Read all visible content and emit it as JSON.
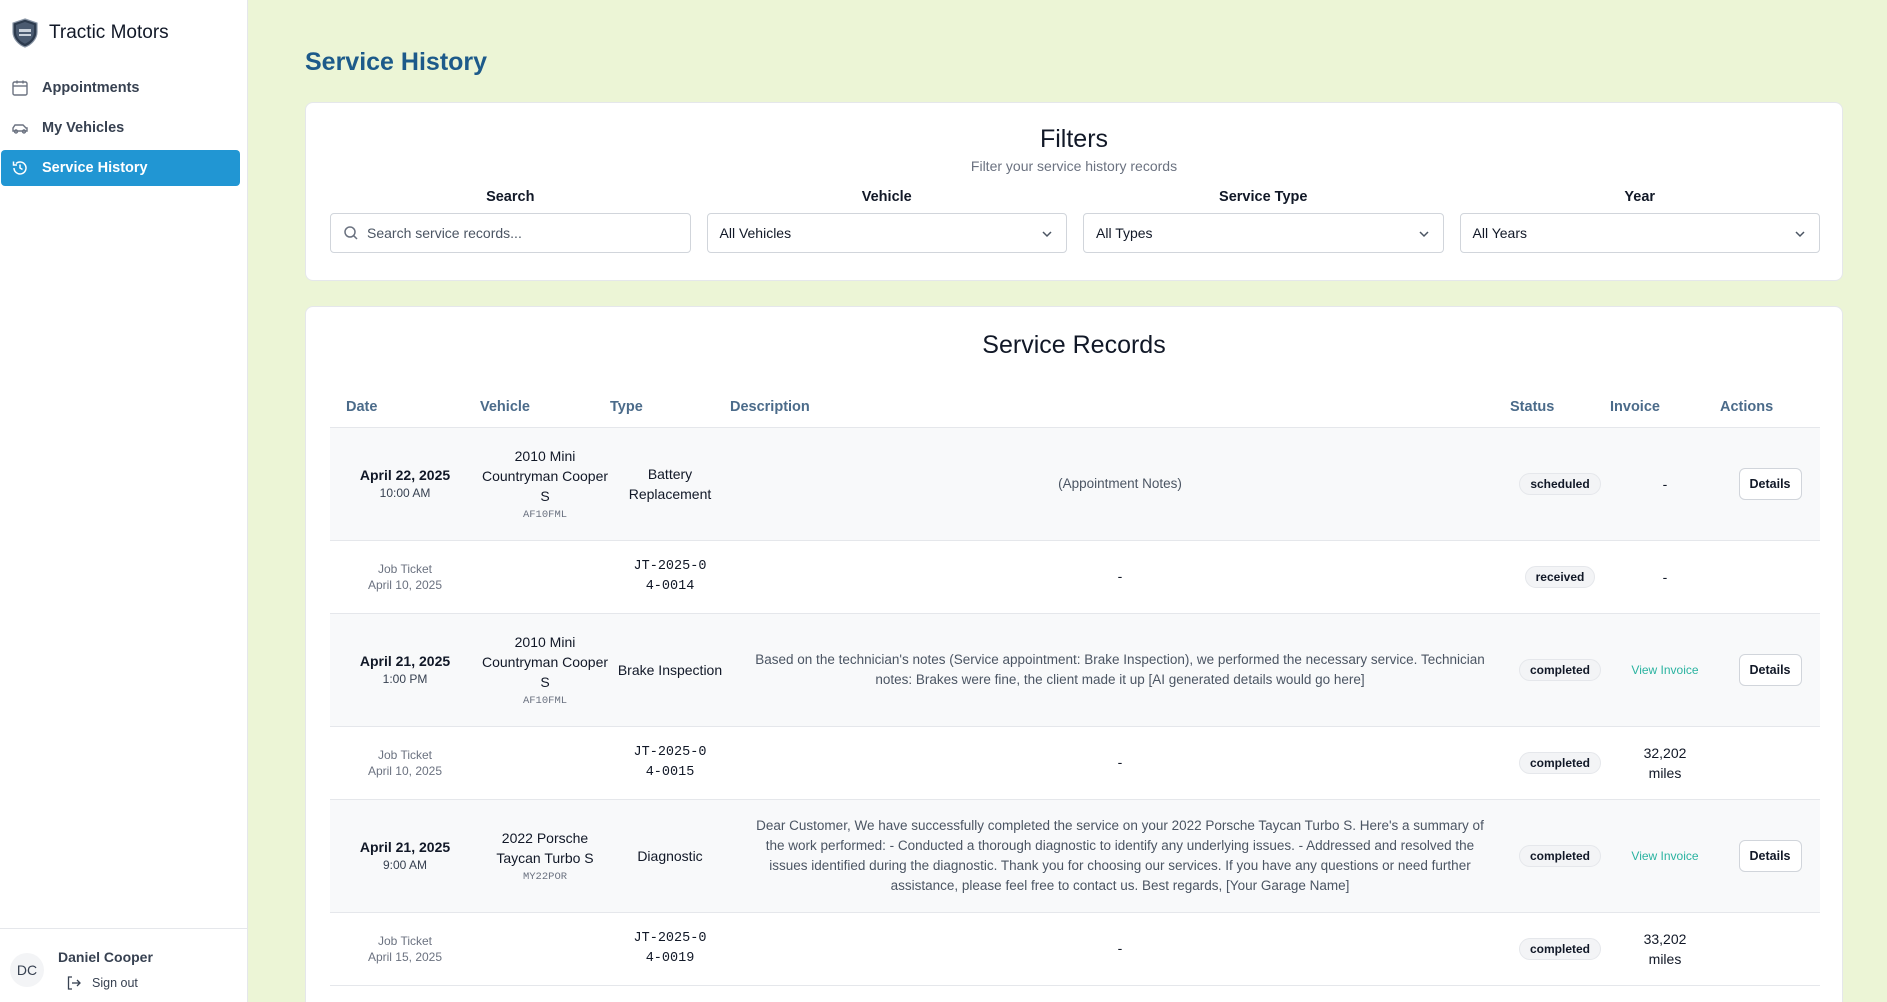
{
  "app": {
    "name": "Tractic Motors"
  },
  "sidebar": {
    "items": [
      {
        "label": "Appointments"
      },
      {
        "label": "My Vehicles"
      },
      {
        "label": "Service History"
      }
    ],
    "user": {
      "initials": "DC",
      "name": "Daniel Cooper",
      "signout_label": "Sign out"
    }
  },
  "page": {
    "title": "Service History"
  },
  "filters": {
    "title": "Filters",
    "subtitle": "Filter your service history records",
    "search_label": "Search",
    "search_placeholder": "Search service records...",
    "vehicle_label": "Vehicle",
    "vehicle_value": "All Vehicles",
    "type_label": "Service Type",
    "type_value": "All Types",
    "year_label": "Year",
    "year_value": "All Years"
  },
  "records": {
    "title": "Service Records",
    "headers": [
      "Date",
      "Vehicle",
      "Type",
      "Description",
      "Status",
      "Invoice",
      "Actions"
    ],
    "rows": [
      {
        "date": "April 22, 2025",
        "time": "10:00 AM",
        "vehicle": "2010 Mini Countryman Cooper S",
        "plate": "AF10FML",
        "type": "Battery Replacement",
        "description": "(Appointment Notes)",
        "status": "scheduled",
        "invoice": "-",
        "action": "Details"
      },
      {
        "ticket_label": "Job Ticket",
        "ticket_date": "April 10, 2025",
        "ticket_no": "JT-2025-04-0014",
        "description": "-",
        "status": "received",
        "invoice": "-"
      },
      {
        "date": "April 21, 2025",
        "time": "1:00 PM",
        "vehicle": "2010 Mini Countryman Cooper S",
        "plate": "AF10FML",
        "type": "Brake Inspection",
        "description": "Based on the technician's notes (Service appointment: Brake Inspection), we performed the necessary service. Technician notes: Brakes were fine, the client made it up [AI generated details would go here]",
        "status": "completed",
        "invoice": "View Invoice",
        "action": "Details"
      },
      {
        "ticket_label": "Job Ticket",
        "ticket_date": "April 10, 2025",
        "ticket_no": "JT-2025-04-0015",
        "description": "-",
        "status": "completed",
        "invoice": "32,202 miles"
      },
      {
        "date": "April 21, 2025",
        "time": "9:00 AM",
        "vehicle": "2022 Porsche Taycan Turbo S",
        "plate": "MY22POR",
        "type": "Diagnostic",
        "description": "Dear Customer, We have successfully completed the service on your 2022 Porsche Taycan Turbo S. Here's a summary of the work performed: - Conducted a thorough diagnostic to identify any underlying issues. - Addressed and resolved the issues identified during the diagnostic. Thank you for choosing our services. If you have any questions or need further assistance, please feel free to contact us. Best regards, [Your Garage Name]",
        "status": "completed",
        "invoice": "View Invoice",
        "action": "Details"
      },
      {
        "ticket_label": "Job Ticket",
        "ticket_date": "April 15, 2025",
        "ticket_no": "JT-2025-04-0019",
        "description": "-",
        "status": "completed",
        "invoice": "33,202 miles"
      }
    ]
  }
}
